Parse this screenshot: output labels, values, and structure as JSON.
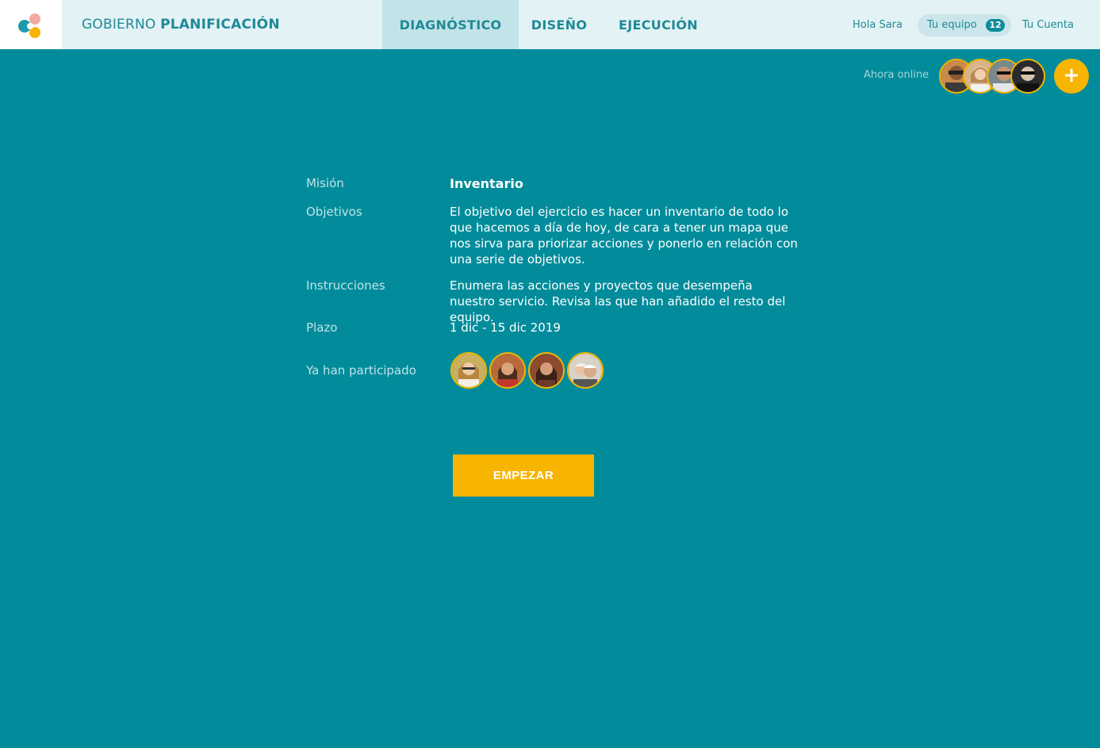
{
  "header": {
    "brand_light": "GOBIERNO",
    "brand_bold": "PLANIFICACIÓN",
    "tabs": [
      {
        "label": "DIAGNÓSTICO",
        "active": true
      },
      {
        "label": "DISEÑO",
        "active": false
      },
      {
        "label": "EJECUCIÓN",
        "active": false
      }
    ],
    "greeting": "Hola Sara",
    "team_label": "Tu equipo",
    "team_count": "12",
    "account_label": "Tu Cuenta"
  },
  "online": {
    "label": "Ahora online",
    "add_label": "+"
  },
  "details": {
    "mission_label": "Misión",
    "mission_value": "Inventario",
    "objectives_label": "Objetivos",
    "objectives_value": "El objetivo del ejercicio es hacer un inventario de todo lo que hacemos a día de hoy, de cara a tener un mapa que nos sirva para priorizar acciones y ponerlo en relación con una serie de objetivos.",
    "instructions_label": "Instrucciones",
    "instructions_value": "Enumera las acciones y proyectos que desempeña nuestro servicio. Revisa las que han añadido el resto del equipo.",
    "deadline_label": "Plazo",
    "deadline_value": "1 dic - 15 dic 2019",
    "participants_label": "Ya han participado"
  },
  "start_button": "EMPEZAR",
  "colors": {
    "background": "#028c9b",
    "header": "#e3f2f4",
    "accent": "#f7b400",
    "active_tab": "#c2e3e7"
  }
}
